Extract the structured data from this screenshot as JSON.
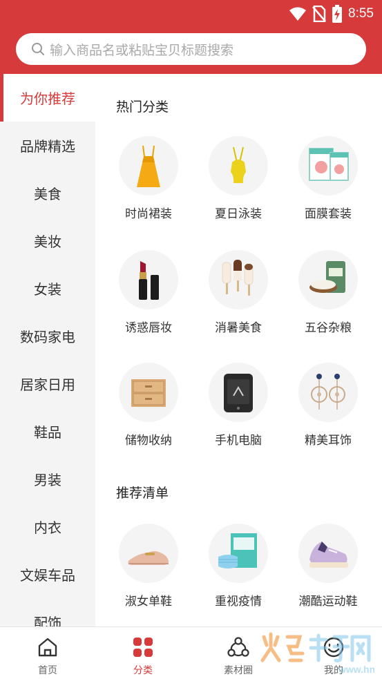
{
  "status_bar": {
    "time": "8:55",
    "icons": [
      "wifi-icon",
      "no-sim-icon",
      "battery-charging-icon"
    ]
  },
  "search": {
    "placeholder": "输入商品名或粘贴宝贝标题搜索",
    "icon": "search-icon"
  },
  "sidebar": {
    "items": [
      {
        "label": "为你推荐",
        "active": true
      },
      {
        "label": "品牌精选"
      },
      {
        "label": "美食"
      },
      {
        "label": "美妆"
      },
      {
        "label": "女装"
      },
      {
        "label": "数码家电"
      },
      {
        "label": "居家日用"
      },
      {
        "label": "鞋品"
      },
      {
        "label": "男装"
      },
      {
        "label": "内衣"
      },
      {
        "label": "文娱车品"
      },
      {
        "label": "配饰"
      }
    ]
  },
  "hot": {
    "title": "热门分类",
    "items": [
      {
        "label": "时尚裙装",
        "icon": "dress-icon"
      },
      {
        "label": "夏日泳装",
        "icon": "swimsuit-icon"
      },
      {
        "label": "面膜套装",
        "icon": "facemask-box-icon"
      },
      {
        "label": "诱惑唇妆",
        "icon": "lipstick-icon"
      },
      {
        "label": "消暑美食",
        "icon": "ice-cream-icon"
      },
      {
        "label": "五谷杂粮",
        "icon": "rice-bag-icon"
      },
      {
        "label": "储物收纳",
        "icon": "storage-drawer-icon"
      },
      {
        "label": "手机电脑",
        "icon": "phone-icon"
      },
      {
        "label": "精美耳饰",
        "icon": "earrings-icon"
      }
    ]
  },
  "recommend": {
    "title": "推荐清单",
    "items": [
      {
        "label": "淑女单鞋",
        "icon": "flat-shoe-icon"
      },
      {
        "label": "重视疫情",
        "icon": "medical-mask-icon"
      },
      {
        "label": "潮酷运动鞋",
        "icon": "sneaker-icon"
      }
    ]
  },
  "tabbar": {
    "tabs": [
      {
        "label": "首页",
        "icon": "home-icon"
      },
      {
        "label": "分类",
        "icon": "category-icon",
        "active": true
      },
      {
        "label": "素材圈",
        "icon": "material-circle-icon"
      },
      {
        "label": "我的",
        "icon": "profile-icon"
      }
    ]
  },
  "colors": {
    "brand": "#d63a3a",
    "sidebar_bg": "#f4f4f4",
    "thumb_bg": "#f4f4f4"
  }
}
